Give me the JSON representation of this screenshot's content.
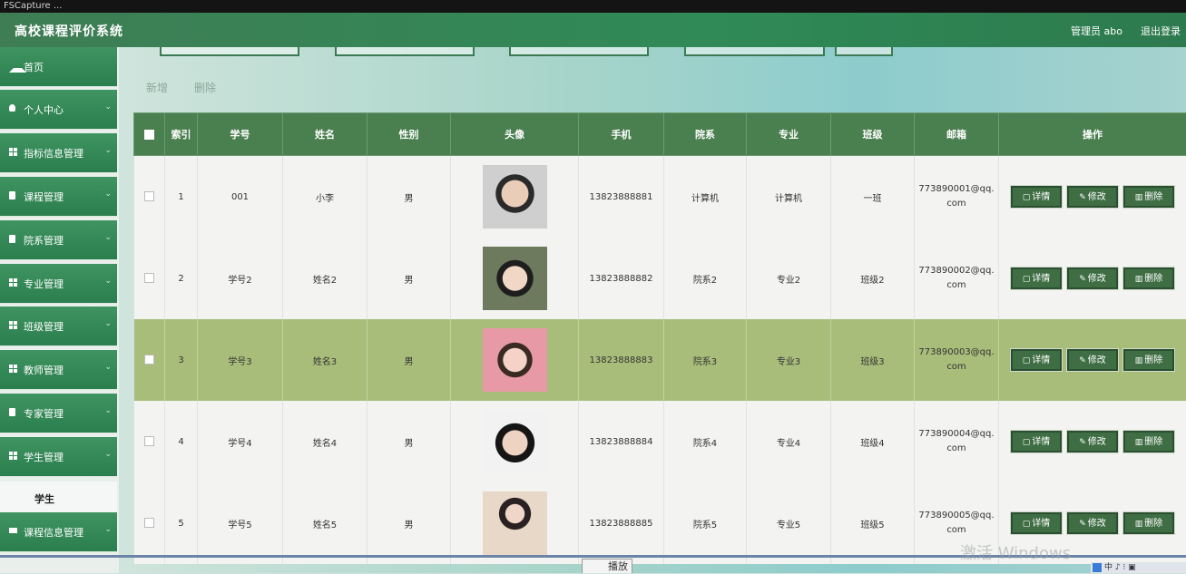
{
  "capture_bar": {
    "text": "FSCapture ..."
  },
  "header": {
    "title": "高校课程评价系统",
    "user": "管理员 abo",
    "logout": "退出登录"
  },
  "sidebar": {
    "items": [
      {
        "label": "首页",
        "icon": "home-icon"
      },
      {
        "label": "个人中心",
        "icon": "user-icon"
      },
      {
        "label": "指标信息管理",
        "icon": "grid-icon"
      },
      {
        "label": "课程管理",
        "icon": "document-icon"
      },
      {
        "label": "院系管理",
        "icon": "document-icon"
      },
      {
        "label": "专业管理",
        "icon": "grid-icon"
      },
      {
        "label": "班级管理",
        "icon": "grid-icon"
      },
      {
        "label": "教师管理",
        "icon": "grid-icon"
      },
      {
        "label": "专家管理",
        "icon": "document-icon"
      },
      {
        "label": "学生管理",
        "icon": "grid-icon"
      },
      {
        "label": "课程信息管理",
        "icon": "monitor-icon"
      }
    ],
    "sub_item": "学生"
  },
  "toolbar": {
    "add_label": "新增",
    "delete_label": "删除"
  },
  "table": {
    "headers": [
      "",
      "索引",
      "学号",
      "姓名",
      "性别",
      "头像",
      "手机",
      "院系",
      "专业",
      "班级",
      "邮箱",
      "操作"
    ],
    "rows": [
      {
        "index": "1",
        "sno": "001",
        "name": "小李",
        "gender": "男",
        "phone": "13823888881",
        "dept": "计算机",
        "major": "计算机",
        "class": "一班",
        "email": "773890001@qq.com"
      },
      {
        "index": "2",
        "sno": "学号2",
        "name": "姓名2",
        "gender": "男",
        "phone": "13823888882",
        "dept": "院系2",
        "major": "专业2",
        "class": "班级2",
        "email": "773890002@qq.com"
      },
      {
        "index": "3",
        "sno": "学号3",
        "name": "姓名3",
        "gender": "男",
        "phone": "13823888883",
        "dept": "院系3",
        "major": "专业3",
        "class": "班级3",
        "email": "773890003@qq.com"
      },
      {
        "index": "4",
        "sno": "学号4",
        "name": "姓名4",
        "gender": "男",
        "phone": "13823888884",
        "dept": "院系4",
        "major": "专业4",
        "class": "班级4",
        "email": "773890004@qq.com"
      },
      {
        "index": "5",
        "sno": "学号5",
        "name": "姓名5",
        "gender": "男",
        "phone": "13823888885",
        "dept": "院系5",
        "major": "专业5",
        "class": "班级5",
        "email": "773890005@qq.com"
      }
    ],
    "buttons": {
      "detail": "详情",
      "edit": "修改",
      "delete": "删除"
    }
  },
  "overlay": {
    "play_label": "播放",
    "watermark": "激活 Windows"
  },
  "colors": {
    "header_green": "#2f8a57",
    "table_header": "#4a7f4f",
    "button_dark": "#3f6e44",
    "highlight_row": "#a9bd7b"
  }
}
